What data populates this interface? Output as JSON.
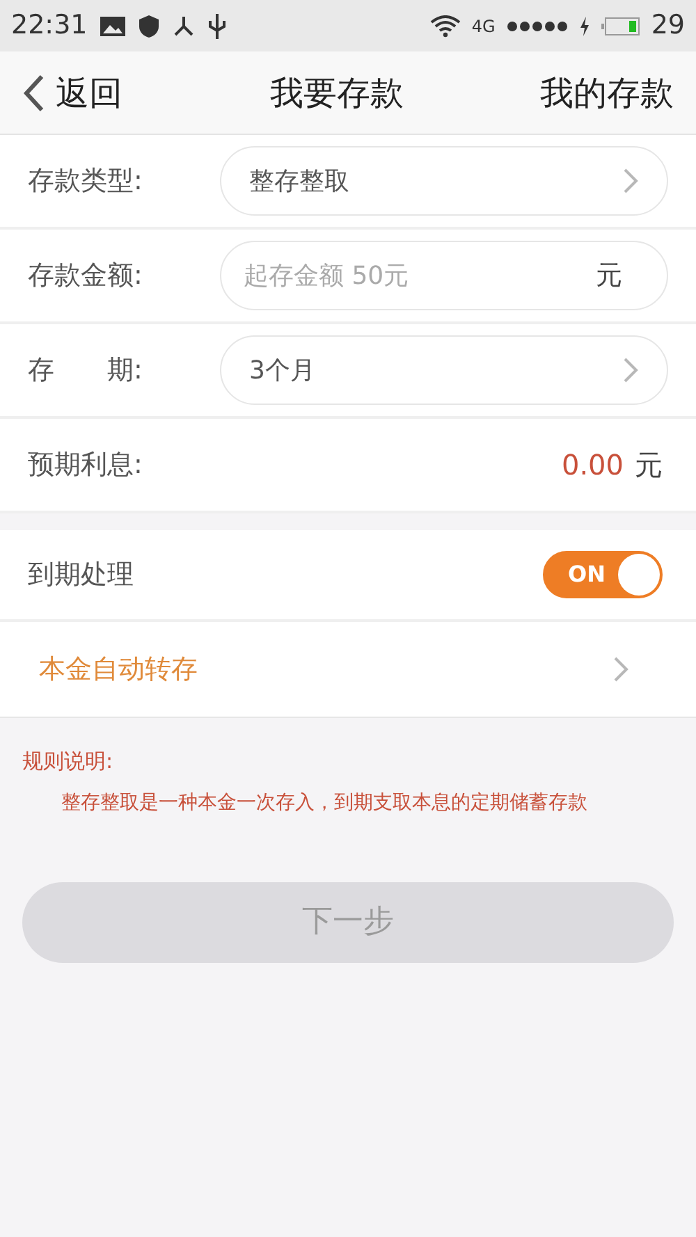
{
  "status_bar": {
    "time": "22:31",
    "network": "4G",
    "battery": "29"
  },
  "header": {
    "back": "返回",
    "title": "我要存款",
    "action": "我的存款"
  },
  "form_rows": [
    {
      "kind": "select",
      "label": "存款类型:",
      "value": "整存整取"
    },
    {
      "kind": "input",
      "label": "存款金额:",
      "placeholder": "起存金额 50元",
      "unit": "元"
    },
    {
      "kind": "select",
      "label": "存　　期:",
      "value": "3个月"
    },
    {
      "kind": "readout",
      "label": "预期利息:",
      "value": "0.00",
      "unit": "元"
    }
  ],
  "maturity": {
    "label": "到期处理",
    "switch_text": "ON",
    "on": true
  },
  "option": {
    "label": "本金自动转存"
  },
  "rules": {
    "title": "规则说明:",
    "text": "整存整取是一种本金一次存入，到期支取本息的定期储蓄存款"
  },
  "next_button": {
    "label": "下一步",
    "disabled": true
  }
}
